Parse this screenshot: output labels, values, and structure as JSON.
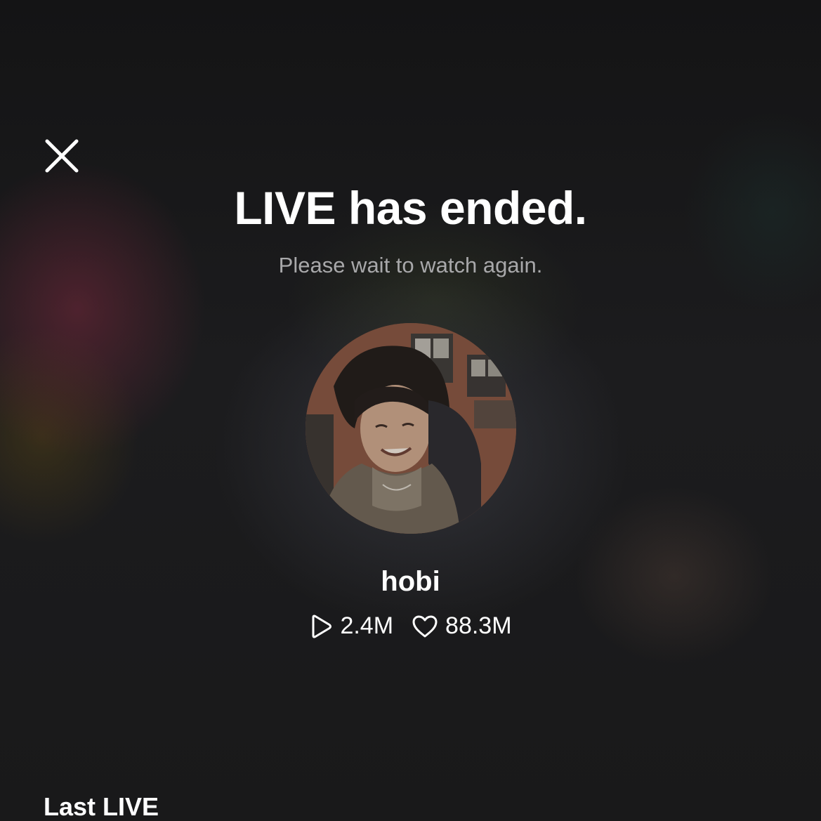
{
  "header": {
    "close_icon": "close-icon"
  },
  "status": {
    "title": "LIVE has ended.",
    "subtitle": "Please wait to watch again."
  },
  "profile": {
    "avatar": "avatar-photo",
    "name": "hobi",
    "views_icon": "play-icon",
    "views": "2.4M",
    "likes_icon": "heart-icon",
    "likes": "88.3M"
  },
  "section": {
    "last_live_label": "Last LIVE"
  },
  "colors": {
    "background": "#1a1a1b",
    "text_primary": "#ffffff",
    "text_secondary": "#a8a8aa"
  }
}
